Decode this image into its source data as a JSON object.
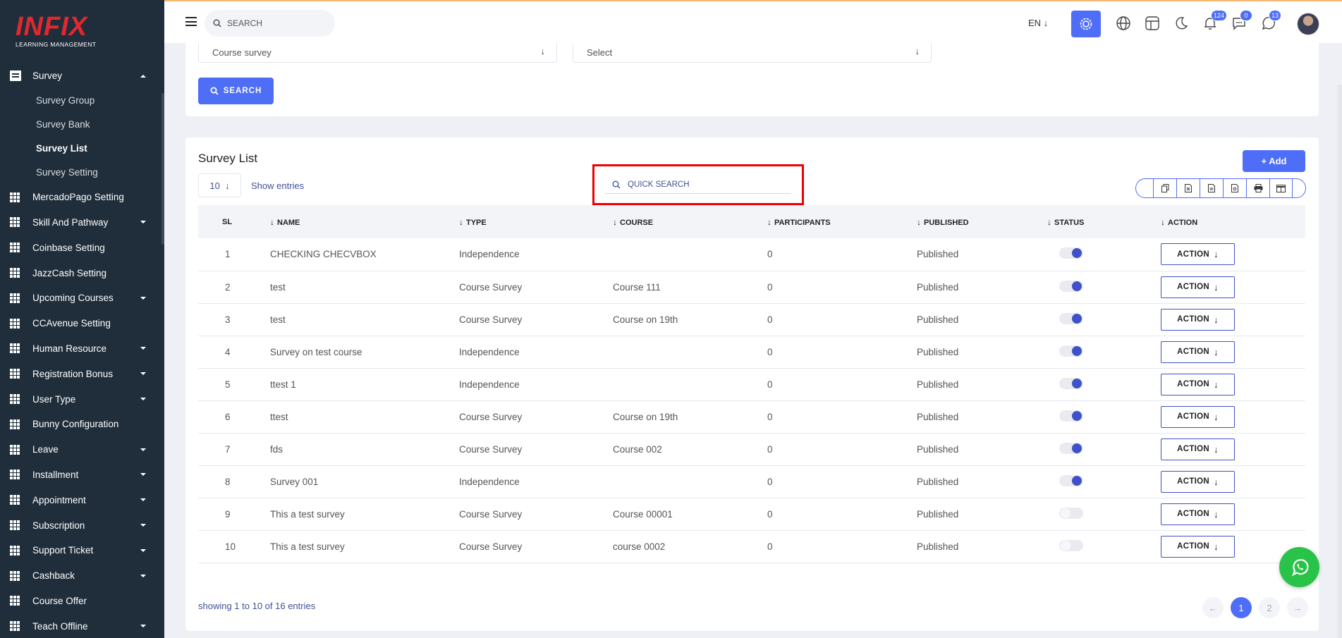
{
  "brand": {
    "logo_text": "INFIX",
    "logo_sub": "LEARNING MANAGEMENT"
  },
  "header": {
    "search_placeholder": "SEARCH",
    "language": "EN",
    "badges": {
      "notifications": "124",
      "messages": "0",
      "whatsapp": "13"
    }
  },
  "sidebar": {
    "survey": {
      "label": "Survey",
      "children": [
        "Survey Group",
        "Survey Bank",
        "Survey List",
        "Survey Setting"
      ],
      "active_child": "Survey List"
    },
    "items": [
      {
        "label": "MercadoPago Setting",
        "caret": false
      },
      {
        "label": "Skill And Pathway",
        "caret": true
      },
      {
        "label": "Coinbase Setting",
        "caret": false
      },
      {
        "label": "JazzCash Setting",
        "caret": false
      },
      {
        "label": "Upcoming Courses",
        "caret": true
      },
      {
        "label": "CCAvenue Setting",
        "caret": false
      },
      {
        "label": "Human Resource",
        "caret": true
      },
      {
        "label": "Registration Bonus",
        "caret": true
      },
      {
        "label": "User Type",
        "caret": true
      },
      {
        "label": "Bunny Configuration",
        "caret": false
      },
      {
        "label": "Leave",
        "caret": true
      },
      {
        "label": "Installment",
        "caret": true
      },
      {
        "label": "Appointment",
        "caret": true
      },
      {
        "label": "Subscription",
        "caret": true
      },
      {
        "label": "Support Ticket",
        "caret": true
      },
      {
        "label": "Cashback",
        "caret": true
      },
      {
        "label": "Course Offer",
        "caret": false
      },
      {
        "label": "Teach Offline",
        "caret": true
      }
    ]
  },
  "filters": {
    "survey_type_value": "Course survey",
    "course_value": "Select",
    "search_button": "SEARCH"
  },
  "list": {
    "title": "Survey List",
    "entries_value": "10",
    "entries_label": "Show entries",
    "quick_search_placeholder": "QUICK SEARCH",
    "add_button": "+ Add",
    "columns": [
      "SL",
      "NAME",
      "TYPE",
      "COURSE",
      "PARTICIPANTS",
      "PUBLISHED",
      "STATUS",
      "ACTION"
    ],
    "action_label": "ACTION",
    "rows": [
      {
        "sl": "1",
        "name": "CHECKING CHECVBOX",
        "type": "Independence",
        "course": "",
        "participants": "0",
        "published": "Published",
        "status_on": true
      },
      {
        "sl": "2",
        "name": "test",
        "type": "Course Survey",
        "course": "Course 111",
        "participants": "0",
        "published": "Published",
        "status_on": true
      },
      {
        "sl": "3",
        "name": "test",
        "type": "Course Survey",
        "course": "Course on 19th",
        "participants": "0",
        "published": "Published",
        "status_on": true
      },
      {
        "sl": "4",
        "name": "Survey on test course",
        "type": "Independence",
        "course": "",
        "participants": "0",
        "published": "Published",
        "status_on": true
      },
      {
        "sl": "5",
        "name": "ttest 1",
        "type": "Independence",
        "course": "",
        "participants": "0",
        "published": "Published",
        "status_on": true
      },
      {
        "sl": "6",
        "name": "ttest",
        "type": "Course Survey",
        "course": "Course on 19th",
        "participants": "0",
        "published": "Published",
        "status_on": true
      },
      {
        "sl": "7",
        "name": "fds",
        "type": "Course Survey",
        "course": "Course 002",
        "participants": "0",
        "published": "Published",
        "status_on": true
      },
      {
        "sl": "8",
        "name": "Survey 001",
        "type": "Independence",
        "course": "",
        "participants": "0",
        "published": "Published",
        "status_on": true
      },
      {
        "sl": "9",
        "name": "This a test survey",
        "type": "Course Survey",
        "course": "Course 00001",
        "participants": "0",
        "published": "Published",
        "status_on": false
      },
      {
        "sl": "10",
        "name": "This a test survey",
        "type": "Course Survey",
        "course": "course 0002",
        "participants": "0",
        "published": "Published",
        "status_on": false
      }
    ],
    "showing_text": "showing 1 to 10 of 16 entries",
    "pages": [
      "1",
      "2"
    ],
    "current_page": "1"
  },
  "colors": {
    "sidebar_bg": "#202E3B",
    "accent": "#4E6EF7",
    "brand_red": "#E2282F",
    "highlight_box": "#EE0000",
    "whatsapp": "#29C34A"
  }
}
